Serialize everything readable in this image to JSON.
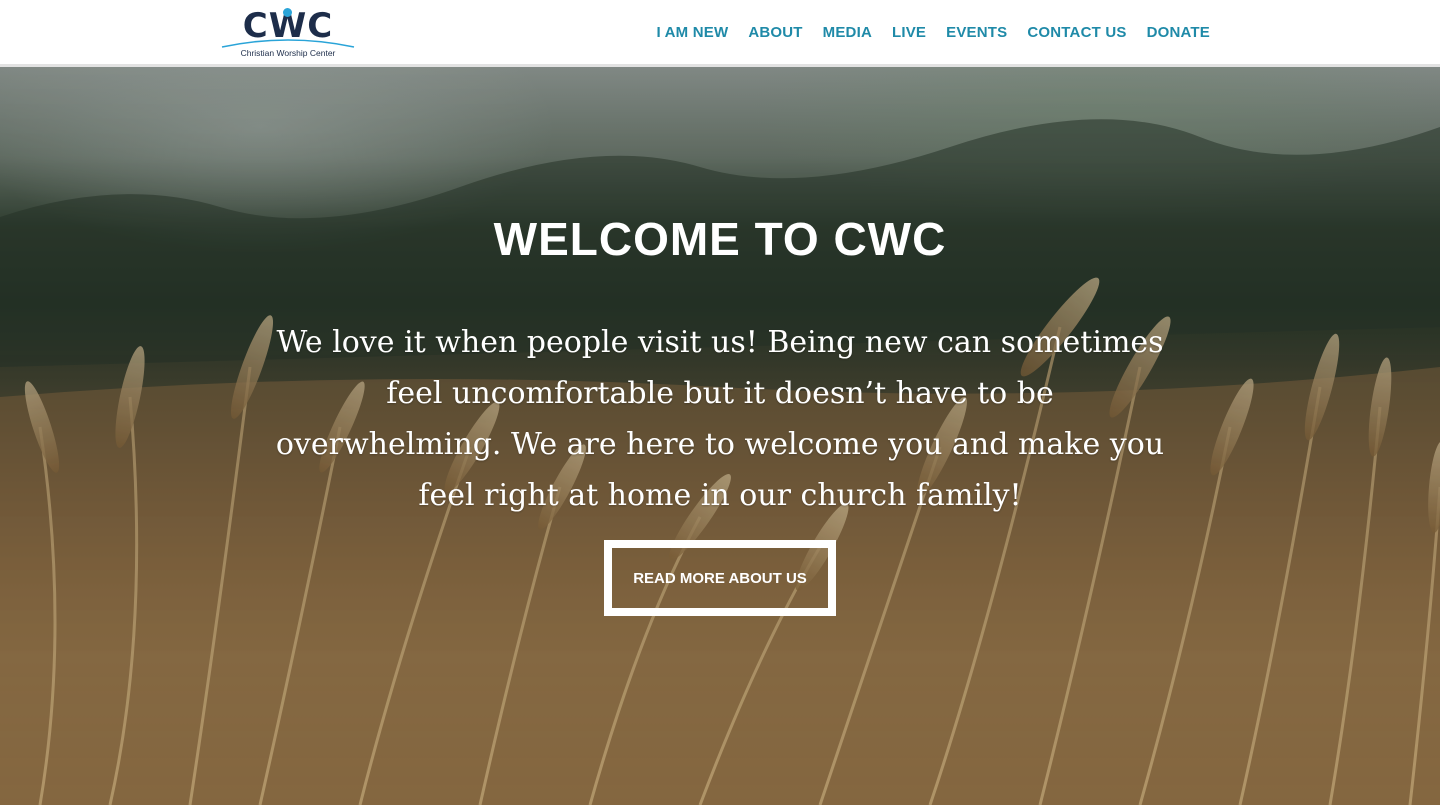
{
  "logo": {
    "mark": "CWC",
    "tagline": "Christian Worship Center"
  },
  "nav": {
    "items": [
      "I AM NEW",
      "ABOUT",
      "MEDIA",
      "LIVE",
      "EVENTS",
      "CONTACT US",
      "DONATE"
    ]
  },
  "hero": {
    "title": "WELCOME TO CWC",
    "body": "We love it when people visit us! Being new can sometimes feel uncomfortable but it doesn’t have to be overwhelming. We are here to welcome you and make you feel right at home in our church family!",
    "button": "READ MORE ABOUT US"
  },
  "colors": {
    "nav_text": "#1f8aa8",
    "logo_navy": "#1d2d4a",
    "logo_accent": "#2aa4d8"
  }
}
